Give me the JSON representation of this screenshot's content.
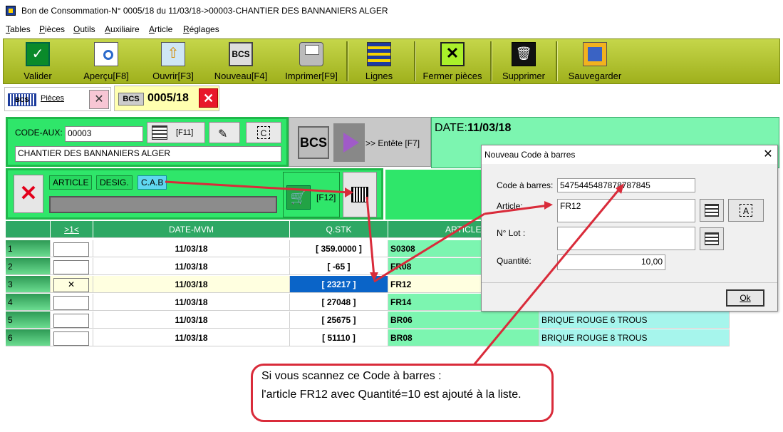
{
  "window": {
    "title": "Bon de Consommation-N° 0005/18 du 11/03/18->00003-CHANTIER DES BANNANIERS ALGER"
  },
  "menu": [
    "Tables",
    "Pièces",
    "Outils",
    "Auxiliaire",
    "Article",
    "Réglages"
  ],
  "toolbar": [
    {
      "label": "Valider",
      "icon": "validate-icon"
    },
    {
      "label": "Aperçu[F8]",
      "icon": "preview-icon"
    },
    {
      "label": "Ouvrir[F3]",
      "icon": "open-icon"
    },
    {
      "label": "Nouveau[F4]",
      "icon": "bcs-new-icon"
    },
    {
      "label": "Imprimer[F9]",
      "icon": "printer-icon"
    },
    {
      "label": "Lignes",
      "icon": "lines-icon"
    },
    {
      "label": "Fermer pièces",
      "icon": "close-pieces-icon"
    },
    {
      "label": "Supprimer",
      "icon": "trash-icon"
    },
    {
      "label": "Sauvegarder",
      "icon": "save-icon"
    }
  ],
  "tabs": {
    "pieces_badge": "BCS",
    "pieces_label": "Pièces",
    "close_glyph": "✕",
    "doc_badge": "BCS",
    "doc_number": "0005/18",
    "doc_close_glyph": "✕"
  },
  "header": {
    "code_aux_label": "CODE-AUX:",
    "code_aux_value": "00003",
    "f11_label": "[F11]",
    "c_label": "C",
    "client_name": "CHANTIER DES BANNANIERS ALGER",
    "bcs_label": "BCS",
    "entete_label": ">> Entête [F7]",
    "date_label": "DATE:",
    "date_value": "11/03/18"
  },
  "article_filter": {
    "clear_glyph": "✕",
    "chips": [
      "ARTICLE",
      "DESIG.",
      "C.A.B"
    ],
    "f12_label": "[F12]"
  },
  "grid": {
    "columns": [
      ">1<",
      "DATE-MVM",
      "Q.STK",
      "ARTICLE"
    ],
    "rows": [
      {
        "n": "1",
        "date": "11/03/18",
        "qty": "[ 359.0000 ]",
        "article": "S0308",
        "desig": ""
      },
      {
        "n": "2",
        "date": "11/03/18",
        "qty": "[ -65 ]",
        "article": "FR08",
        "desig": ""
      },
      {
        "n": "3",
        "date": "11/03/18",
        "qty": "[ 23217 ]",
        "article": "FR12",
        "desig": ""
      },
      {
        "n": "4",
        "date": "11/03/18",
        "qty": "[ 27048 ]",
        "article": "FR14",
        "desig": ""
      },
      {
        "n": "5",
        "date": "11/03/18",
        "qty": "[ 25675 ]",
        "article": "BR06",
        "desig": "BRIQUE ROUGE 6 TROUS"
      },
      {
        "n": "6",
        "date": "11/03/18",
        "qty": "[ 51110 ]",
        "article": "BR08",
        "desig": "BRIQUE ROUGE 8 TROUS"
      }
    ]
  },
  "dialog": {
    "title": "Nouveau Code à barres",
    "close_glyph": "✕",
    "barcode_label": "Code à barres:",
    "barcode_value": "5475445487878787845",
    "article_label": "Article:",
    "article_value": "FR12",
    "lot_label": "N° Lot :",
    "lot_value": "",
    "qty_label": "Quantité:",
    "qty_value": "10,00",
    "a_label": "A",
    "ok_label": "Ok"
  },
  "callout": {
    "line1": "Si vous scannez ce Code à barres :",
    "line2": "l'article FR12 avec  Quantité=10  est ajouté à la liste."
  },
  "colors": {
    "toolbar": "#b5c631",
    "header_green": "#2fe66a",
    "date_panel": "#7cf5b0",
    "selected_qty": "#0a64c8",
    "annotation": "#d92b3a"
  }
}
